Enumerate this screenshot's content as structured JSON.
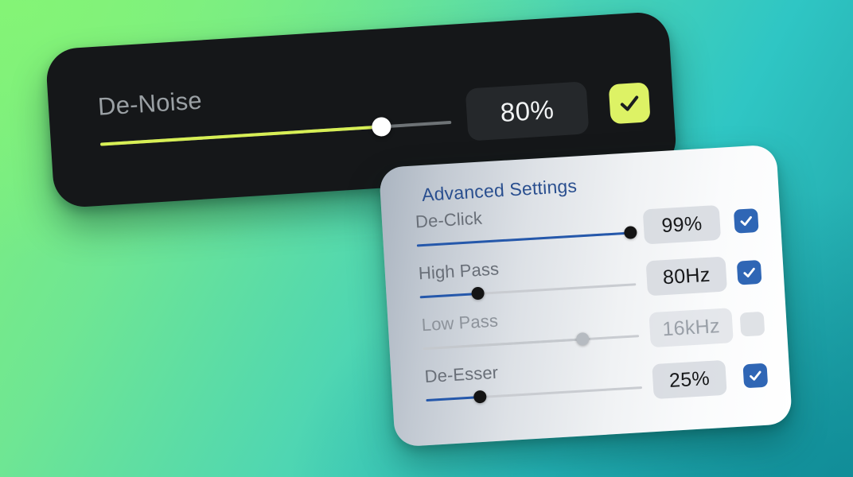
{
  "background": {
    "gradient_from": "#7fef7c",
    "gradient_to": "#1f9fa4"
  },
  "denoise_card": {
    "accent_color": "#d7ef55",
    "background_color": "#151719",
    "label": "De-Noise",
    "value": "80%",
    "slider_percent": 80,
    "checkbox": {
      "icon": "check-icon",
      "checked": true,
      "color": "#ddf265"
    }
  },
  "advanced_panel": {
    "title": "Advanced Settings",
    "title_color": "#2a4f8f",
    "accent_color": "#2558ab",
    "checkbox_color": "#2f66b5",
    "rows": [
      {
        "label": "De-Click",
        "value": "99%",
        "slider_percent": 99,
        "enabled": true,
        "checkbox_icon": "check-icon"
      },
      {
        "label": "High Pass",
        "value": "80Hz",
        "slider_percent": 27,
        "enabled": true,
        "checkbox_icon": "check-icon"
      },
      {
        "label": "Low Pass",
        "value": "16kHz",
        "slider_percent": 74,
        "enabled": false,
        "checkbox_icon": "check-icon"
      },
      {
        "label": "De-Esser",
        "value": "25%",
        "slider_percent": 25,
        "enabled": true,
        "checkbox_icon": "check-icon"
      }
    ]
  }
}
